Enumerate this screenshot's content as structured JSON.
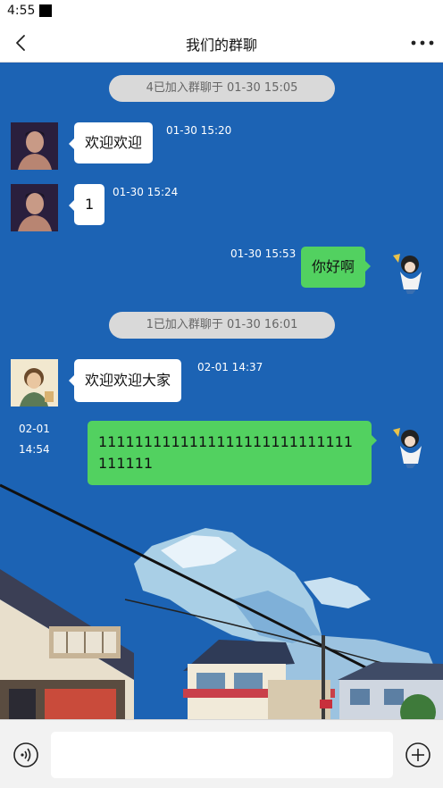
{
  "status": {
    "time": "4:55"
  },
  "nav": {
    "title": "我们的群聊"
  },
  "messages": {
    "sys1": "4已加入群聊于 01-30 15:05",
    "m1": {
      "text": "欢迎欢迎",
      "time": "01-30 15:20"
    },
    "m2": {
      "text": "1",
      "time": "01-30 15:24"
    },
    "m3": {
      "text": "你好啊",
      "time": "01-30 15:53"
    },
    "sys2": "1已加入群聊于 01-30 16:01",
    "m4": {
      "text": "欢迎欢迎大家",
      "time": "02-01 14:37"
    },
    "m5": {
      "text": "1111111111111111111111111111111111",
      "time_date": "02-01",
      "time_clock": "14:54"
    }
  },
  "input": {
    "value": ""
  },
  "icons": {
    "back": "chevron-left-icon",
    "more": "more-dots-icon",
    "voice": "voice-icon",
    "plus": "plus-icon"
  }
}
